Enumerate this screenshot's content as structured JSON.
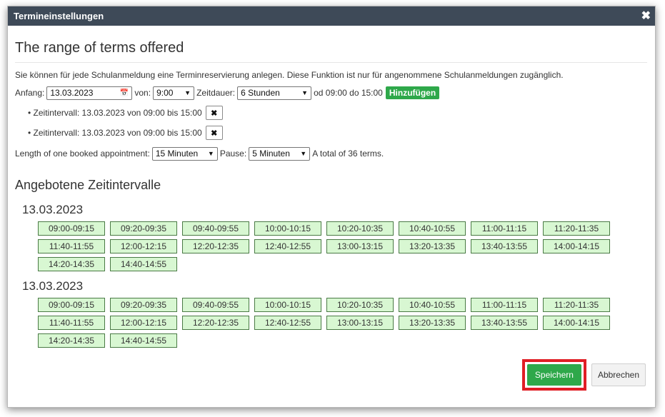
{
  "dialog": {
    "title": "Termineinstellungen",
    "close_glyph": "✖",
    "heading": "The range of terms offered",
    "description": "Sie können für jede Schulanmeldung eine Terminreservierung anlegen. Diese Funktion ist nur für angenommene Schulanmeldungen zugänglich."
  },
  "form": {
    "start_label": "Anfang:",
    "start_value": "13.03.2023",
    "from_label": "von:",
    "from_value": "9:00",
    "duration_label": "Zeitdauer:",
    "duration_value": "6 Stunden",
    "range_text": "od 09:00 do 15:00",
    "add_label": "Hinzufügen"
  },
  "intervals": [
    {
      "text": "• Zeitintervall: 13.03.2023 von 09:00 bis 15:00",
      "delete_glyph": "✖"
    },
    {
      "text": "• Zeitintervall: 13.03.2023 von 09:00 bis 15:00",
      "delete_glyph": "✖"
    }
  ],
  "settings": {
    "length_label": "Length of one booked appointment:",
    "length_value": "15 Minuten",
    "pause_label": "Pause:",
    "pause_value": "5 Minuten",
    "total_text": "A total of 36 terms."
  },
  "offered": {
    "heading": "Angebotene Zeitintervalle",
    "groups": [
      {
        "date": "13.03.2023",
        "slots": [
          "09:00-09:15",
          "09:20-09:35",
          "09:40-09:55",
          "10:00-10:15",
          "10:20-10:35",
          "10:40-10:55",
          "11:00-11:15",
          "11:20-11:35",
          "11:40-11:55",
          "12:00-12:15",
          "12:20-12:35",
          "12:40-12:55",
          "13:00-13:15",
          "13:20-13:35",
          "13:40-13:55",
          "14:00-14:15",
          "14:20-14:35",
          "14:40-14:55"
        ]
      },
      {
        "date": "13.03.2023",
        "slots": [
          "09:00-09:15",
          "09:20-09:35",
          "09:40-09:55",
          "10:00-10:15",
          "10:20-10:35",
          "10:40-10:55",
          "11:00-11:15",
          "11:20-11:35",
          "11:40-11:55",
          "12:00-12:15",
          "12:20-12:35",
          "12:40-12:55",
          "13:00-13:15",
          "13:20-13:35",
          "13:40-13:55",
          "14:00-14:15",
          "14:20-14:35",
          "14:40-14:55"
        ]
      }
    ]
  },
  "footer": {
    "save_label": "Speichern",
    "cancel_label": "Abbrechen"
  },
  "colors": {
    "titlebar": "#3e4a58",
    "accent_green": "#2ea84a",
    "slot_bg": "#d8f7d2",
    "highlight_red": "#e01e25"
  },
  "icons": {
    "close": "close-icon",
    "calendar": "calendar-icon",
    "dropdown": "chevron-down-icon",
    "delete": "delete-icon"
  }
}
